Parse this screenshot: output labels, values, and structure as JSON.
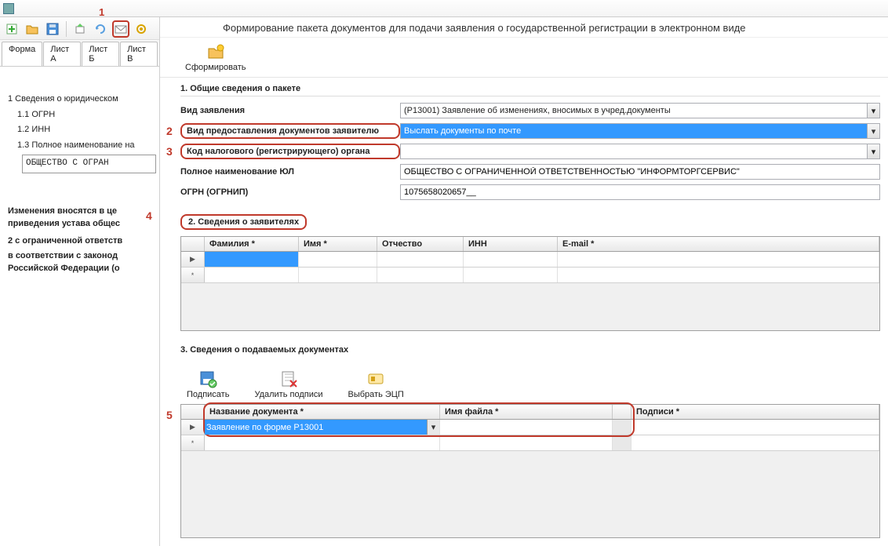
{
  "annotations": {
    "1": "1",
    "2": "2",
    "3": "3",
    "4": "4",
    "5": "5"
  },
  "header_title": "Формирование пакета документов для подачи заявления о государственной регистрации в электронном виде",
  "toolbar": {
    "form_btn": "Сформировать"
  },
  "tabs": {
    "forma": "Форма",
    "listA": "Лист А",
    "listB": "Лист Б",
    "listV": "Лист В"
  },
  "tree": {
    "n1": "1  Сведения о юридическом",
    "n11": "1.1  ОГРН",
    "n12": "1.2  ИНН",
    "n13": "1.3  Полное наименование на",
    "name_box": "ОБЩЕСТВО  С  ОГРАН",
    "note": "Изменения вносятся в це приведения устава общес",
    "n2": "2  с ограниченной ответств",
    "note2": "в соответствии с законод Российской Федерации (о"
  },
  "sec1": {
    "title": "1. Общие сведения о пакете",
    "f1_label": "Вид заявления",
    "f1_value": "(Р13001) Заявление об изменениях, вносимых в учред.документы",
    "f2_label": "Вид предоставления документов заявителю",
    "f2_value": "Выслать документы по почте",
    "f3_label": "Код налогового (регистрирующего) органа",
    "f3_value": "",
    "f4_label": "Полное наименование ЮЛ",
    "f4_value": "ОБЩЕСТВО С ОГРАНИЧЕННОЙ ОТВЕТСТВЕННОСТЬЮ \"ИНФОРМТОРГСЕРВИС\"",
    "f5_label": "ОГРН (ОГРНИП)",
    "f5_value": "1075658020657__"
  },
  "sec2": {
    "title": "2. Сведения о заявителях",
    "cols": {
      "c1": "Фамилия *",
      "c2": "Имя *",
      "c3": "Отчество",
      "c4": "ИНН",
      "c5": "E-mail *"
    }
  },
  "sec3": {
    "title": "3. Сведения о подаваемых документах",
    "btn_sign": "Подписать",
    "btn_delsig": "Удалить подписи",
    "btn_selecp": "Выбрать ЭЦП",
    "cols": {
      "c1": "Название документа *",
      "c2": "Имя файла *",
      "c3": "Подписи *"
    },
    "row1_name": "Заявление по форме Р13001"
  }
}
